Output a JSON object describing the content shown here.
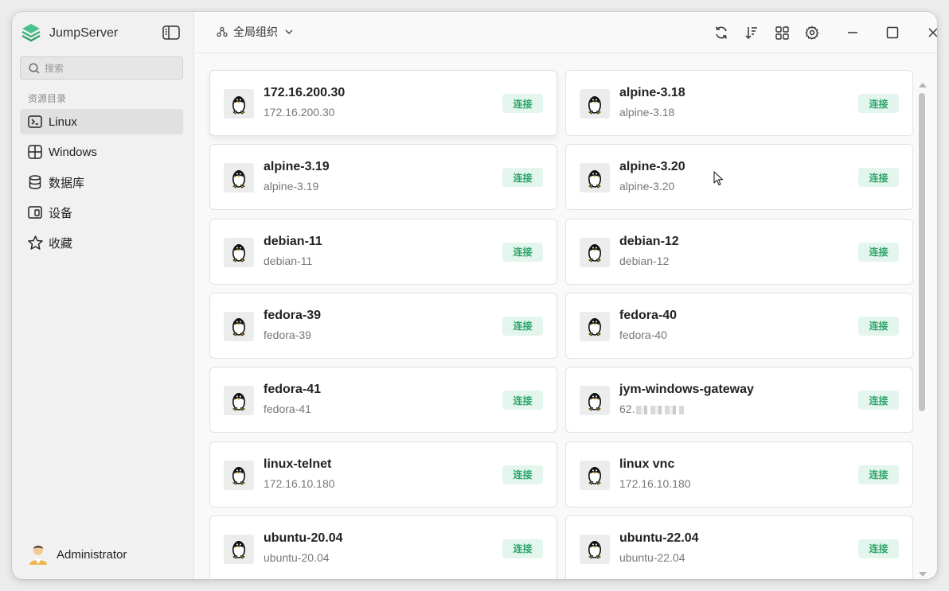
{
  "app": {
    "name": "JumpServer"
  },
  "sidebar": {
    "search_placeholder": "搜索",
    "section_label": "资源目录",
    "items": [
      {
        "label": "Linux",
        "icon": "terminal-icon",
        "active": true
      },
      {
        "label": "Windows",
        "icon": "windows-icon",
        "active": false
      },
      {
        "label": "数据库",
        "icon": "database-icon",
        "active": false
      },
      {
        "label": "设备",
        "icon": "device-icon",
        "active": false
      },
      {
        "label": "收藏",
        "icon": "star-icon",
        "active": false
      }
    ],
    "user": {
      "name": "Administrator"
    }
  },
  "topbar": {
    "org_label": "全局组织",
    "buttons": [
      "refresh-icon",
      "sort-icon",
      "grid-view-icon",
      "settings-icon",
      "minimize-icon",
      "maximize-icon",
      "close-icon"
    ]
  },
  "assets": [
    {
      "name": "172.16.200.30",
      "address": "172.16.200.30",
      "action": "连接",
      "os": "linux-icon"
    },
    {
      "name": "alpine-3.18",
      "address": "alpine-3.18",
      "action": "连接",
      "os": "linux-icon"
    },
    {
      "name": "alpine-3.19",
      "address": "alpine-3.19",
      "action": "连接",
      "os": "linux-icon"
    },
    {
      "name": "alpine-3.20",
      "address": "alpine-3.20",
      "action": "连接",
      "os": "linux-icon"
    },
    {
      "name": "debian-11",
      "address": "debian-11",
      "action": "连接",
      "os": "linux-icon"
    },
    {
      "name": "debian-12",
      "address": "debian-12",
      "action": "连接",
      "os": "linux-icon"
    },
    {
      "name": "fedora-39",
      "address": "fedora-39",
      "action": "连接",
      "os": "linux-icon"
    },
    {
      "name": "fedora-40",
      "address": "fedora-40",
      "action": "连接",
      "os": "linux-icon"
    },
    {
      "name": "fedora-41",
      "address": "fedora-41",
      "action": "连接",
      "os": "linux-icon"
    },
    {
      "name": "jym-windows-gateway",
      "address": "62.",
      "address_redacted": true,
      "action": "连接",
      "os": "linux-icon"
    },
    {
      "name": "linux-telnet",
      "address": "172.16.10.180",
      "action": "连接",
      "os": "linux-icon"
    },
    {
      "name": "linux vnc",
      "address": "172.16.10.180",
      "action": "连接",
      "os": "linux-icon"
    },
    {
      "name": "ubuntu-20.04",
      "address": "ubuntu-20.04",
      "action": "连接",
      "os": "linux-icon"
    },
    {
      "name": "ubuntu-22.04",
      "address": "ubuntu-22.04",
      "action": "连接",
      "os": "linux-icon"
    }
  ],
  "colors": {
    "accent": "#2da56b",
    "accent_bg": "#e3f5ec",
    "brand": "#3bb07a"
  }
}
